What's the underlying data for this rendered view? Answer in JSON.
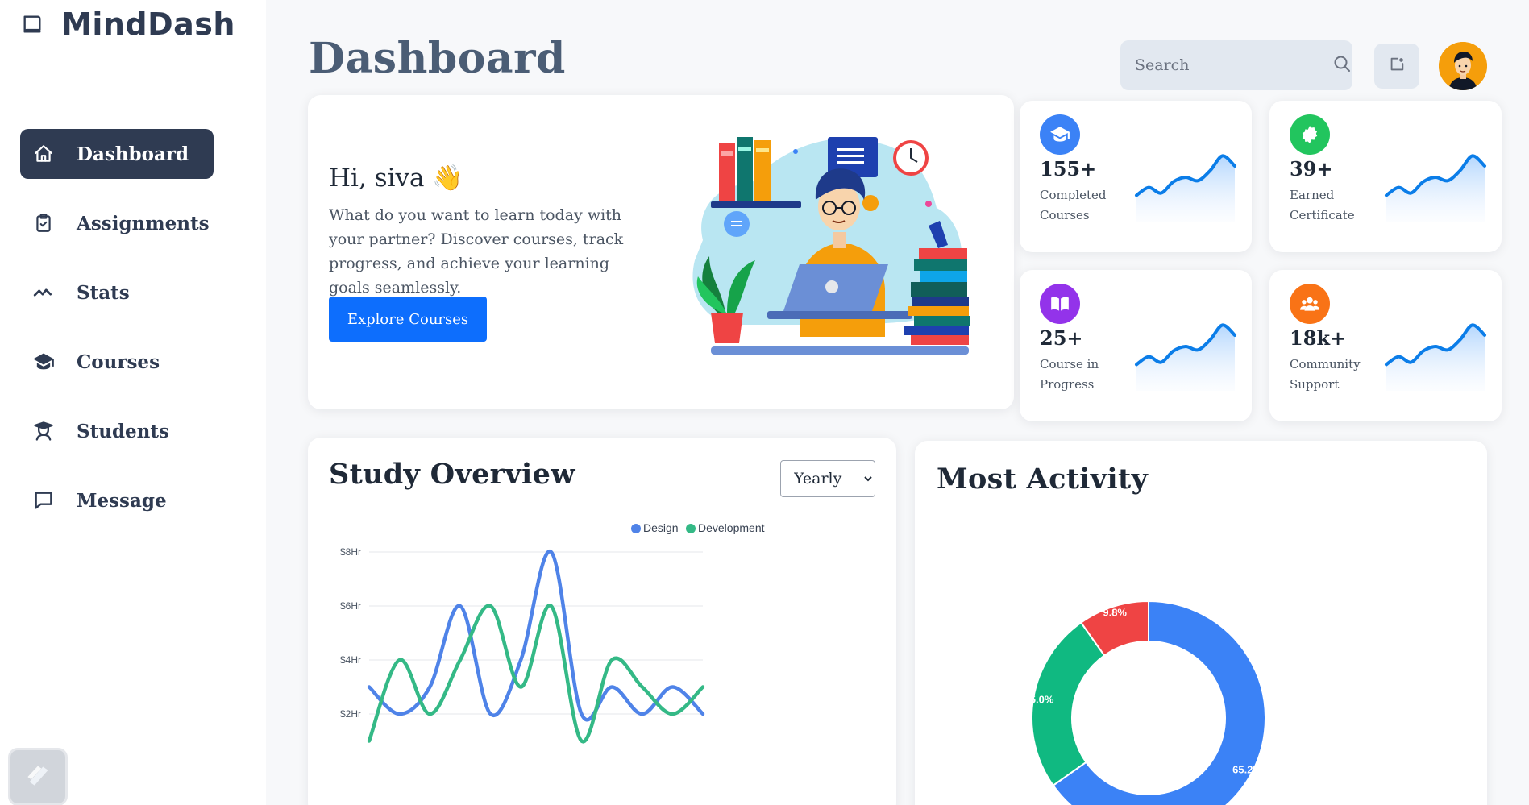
{
  "app": {
    "name": "MindDash"
  },
  "sidebar": {
    "items": [
      {
        "label": "Dashboard",
        "icon": "home-icon",
        "active": true
      },
      {
        "label": "Assignments",
        "icon": "clipboard-check-icon",
        "active": false
      },
      {
        "label": "Stats",
        "icon": "trend-icon",
        "active": false
      },
      {
        "label": "Courses",
        "icon": "graduation-cap-icon",
        "active": false
      },
      {
        "label": "Students",
        "icon": "student-icon",
        "active": false
      },
      {
        "label": "Message",
        "icon": "message-icon",
        "active": false
      }
    ]
  },
  "header": {
    "title": "Dashboard",
    "search_placeholder": "Search"
  },
  "hero": {
    "greeting": "Hi, siva",
    "emoji": "👋",
    "description": "What do you want to learn today with your partner? Discover courses, track progress, and achieve your learning goals seamlessly.",
    "button_label": "Explore Courses"
  },
  "stats": [
    {
      "value": "155+",
      "label": "Completed Courses",
      "icon": "graduation-cap-icon",
      "color": "#3b82f6"
    },
    {
      "value": "39+",
      "label": "Earned Certificate",
      "icon": "badge-icon",
      "color": "#22c55e"
    },
    {
      "value": "25+",
      "label": "Course in Progress",
      "icon": "book-open-icon",
      "color": "#9333ea"
    },
    {
      "value": "18k+",
      "label": "Community Support",
      "icon": "users-icon",
      "color": "#f97316"
    }
  ],
  "overview": {
    "title": "Study Overview",
    "period": "Yearly",
    "period_options": [
      "Yearly"
    ]
  },
  "activity": {
    "title": "Most Activity"
  },
  "chart_data": [
    {
      "type": "line",
      "title": "Study Overview",
      "y_ticks": [
        "$2Hr",
        "$4Hr",
        "$6Hr",
        "$8Hr"
      ],
      "ylim": [
        2,
        8
      ],
      "legend_position": "top-right",
      "series": [
        {
          "name": "Design",
          "color": "#4f83e8",
          "values": [
            3,
            2,
            3,
            6,
            2,
            4,
            8,
            2,
            3,
            2,
            3,
            2
          ]
        },
        {
          "name": "Development",
          "color": "#34b986",
          "values": [
            1,
            4,
            2,
            4,
            6,
            3,
            6,
            1,
            4,
            3,
            2,
            3
          ]
        }
      ]
    },
    {
      "type": "pie",
      "title": "Most Activity",
      "slices": [
        {
          "label": "65.2%",
          "value": 65.2,
          "color": "#3b82f6"
        },
        {
          "label": "25.0%",
          "value": 25.0,
          "color": "#10b981"
        },
        {
          "label": "9.8%",
          "value": 9.8,
          "color": "#ef4444"
        }
      ]
    }
  ]
}
